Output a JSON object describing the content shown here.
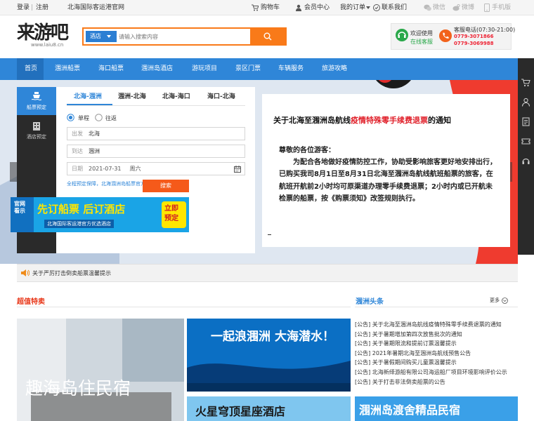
{
  "topbar": {
    "login": "登录",
    "sep": "|",
    "register": "注册",
    "site_name": "北海国际客运港官网",
    "cart": "购物车",
    "member": "会员中心",
    "orders": "我的订单",
    "contact": "联系我们",
    "wechat": "微信",
    "weibo": "微博",
    "mobile": "手机版"
  },
  "header": {
    "logo_text": "来游吧",
    "logo_url": "www.laiu8.cn",
    "search_category": "酒店",
    "search_placeholder": "请输入搜索内容",
    "welcome": "欢迎使用",
    "online_service": "在线客服",
    "hotline_label": "客服电话(07:30-21:00)",
    "phone1": "0779-3071866",
    "phone2": "0779-3069988"
  },
  "nav": {
    "items": [
      "首页",
      "涠洲船票",
      "海口船票",
      "涠洲岛酒店",
      "游玩项目",
      "景区门票",
      "车辆服务",
      "旅游攻略"
    ]
  },
  "booking": {
    "side_tabs": [
      "船票预定",
      "酒店预定"
    ],
    "route_tabs": [
      "北海-涠洲",
      "涠洲-北海",
      "北海-海口",
      "海口-北海"
    ],
    "trip_one_way": "单程",
    "trip_round": "往返",
    "from_label": "出发",
    "from_value": "北海",
    "to_label": "到达",
    "to_value": "涠洲",
    "date_label": "日期",
    "date_value": "2021-07-31",
    "weekday": "周六",
    "guarantee": "全程预定保障，北海涠洲岛船票官方平台",
    "search_button": "搜索",
    "ad": {
      "badge": "官网看示",
      "headline": "先订船票 后订酒店",
      "sub": "北海国际客运港官方优选酒店",
      "cta": "立即预定"
    }
  },
  "notice": {
    "title_pre": "关于北海至涠洲岛航线",
    "title_red": "疫情特殊零手续费退票",
    "title_post": "的通知",
    "greeting": "尊敬的各位游客：",
    "paragraph": "为配合各地做好疫情防控工作，协助受影响旅客更好地安排出行，已购买我司8月1日至8月31日北海至涠洲岛航线航班船票的旅客，在航班开航前2小时均可原渠道办理零手续费退票；2小时内或已开航未检票的船票，按《购票须知》改签规则执行。"
  },
  "alert_strip": "关于严厉打击倒卖船票温馨提示",
  "specials": {
    "title": "超值特卖",
    "card1_text": "趣海岛住民宿",
    "card2_text": "一起浪涠洲 大海潜水！",
    "card3_text": "火星穹顶星座酒店",
    "card4_text": "涠洲岛渡舍精品民宿"
  },
  "headlines": {
    "title": "涠洲头条",
    "more": "更多",
    "items": [
      "[公告] 关于北海至涠洲岛航线疫情特殊零手续费退票的通知",
      "[公告] 关于暑期增加第四次放售批次的通知",
      "[公告] 关于暑期限流和提前订票温馨提示",
      "[公告] 2021年暑期北海至涠洲岛航线预售公告",
      "[公告] 关于暑假期间购买儿童票温馨提示",
      "[公告] 北海新绎游船有限公司海运船厂项目环境影响评价公示",
      "[公告] 关于打击非法倒卖船票的公告"
    ]
  },
  "colors": {
    "brand_blue": "#2f86d8",
    "accent_orange": "#f97a19",
    "alert_red": "#e0202a"
  }
}
